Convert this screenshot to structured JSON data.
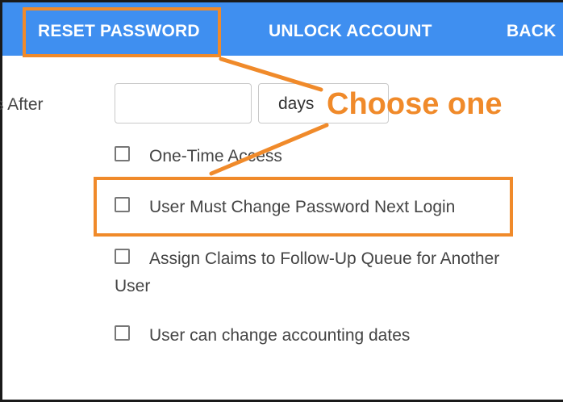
{
  "toolbar": {
    "reset_password": "RESET PASSWORD",
    "unlock_account": "UNLOCK ACCOUNT",
    "back": "BACK"
  },
  "form": {
    "expire_label": "s After",
    "expire_value": "",
    "unit_selected": "days",
    "checkboxes": [
      {
        "label": "One-Time Access",
        "checked": false
      },
      {
        "label": "User Must Change Password Next Login",
        "checked": false
      },
      {
        "label_line1": "Assign Claims to Follow-Up Queue for Another",
        "label_line2": "User",
        "checked": false
      },
      {
        "label": "User can change accounting dates",
        "checked": false
      }
    ]
  },
  "annotation": {
    "text": "Choose one",
    "color": "#f08a2a"
  },
  "colors": {
    "toolbar_bg": "#3f8ff0",
    "annotation": "#f08a2a"
  }
}
